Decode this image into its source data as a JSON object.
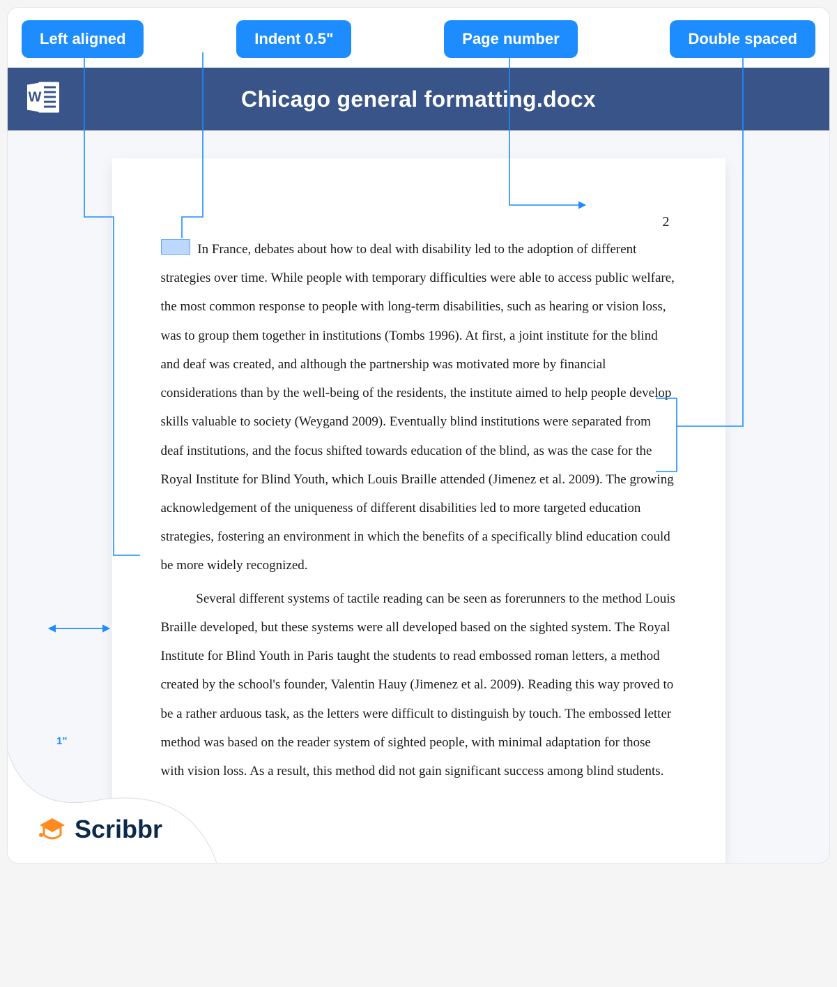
{
  "labels": {
    "left_aligned": "Left aligned",
    "indent": "Indent 0.5\"",
    "page_number": "Page number",
    "double_spaced": "Double spaced"
  },
  "titlebar": {
    "filename": "Chicago general formatting.docx"
  },
  "page": {
    "number": "2",
    "paragraph1": "In France, debates about how to deal with disability led to the adoption of different strategies over time. While people with temporary difficulties were able to access public welfare, the most common response to people with long-term disabilities, such as hearing or vision loss, was to group them together in institutions (Tombs 1996). At first, a joint institute for the blind and deaf was created, and although the partnership was motivated more by financial considerations than by the well-being of the residents, the institute aimed to help people develop skills valuable to society (Weygand 2009). Eventually blind institutions were separated from deaf institutions, and the focus shifted towards education of the blind, as was the case for the Royal Institute for Blind Youth, which Louis Braille attended (Jimenez et al. 2009). The growing acknowledgement of the uniqueness of different disabilities led to more targeted education strategies, fostering an environment in which the benefits of a specifically blind education could be more widely recognized.",
    "paragraph2": "Several different systems of tactile reading can be seen as forerunners to the method Louis Braille developed, but these systems were all developed based on the sighted system. The Royal Institute for Blind Youth in Paris taught the students to read embossed roman letters, a method created by the school's founder, Valentin Hauy (Jimenez et al. 2009). Reading this way proved to be a rather arduous task, as the letters were difficult to distinguish by touch. The embossed letter method was based on the reader system of sighted people, with minimal adaptation for those with vision loss. As a result, this method did not gain significant success among blind students."
  },
  "margin_label": "1\"",
  "brand": "Scribbr"
}
